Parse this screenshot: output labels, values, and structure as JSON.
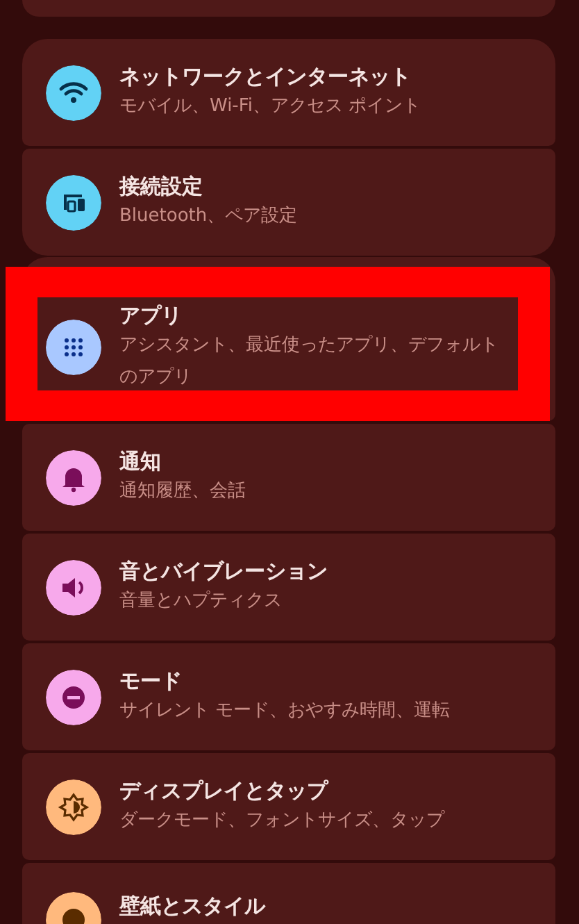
{
  "groups": [
    {
      "items": [
        {
          "title": "ネットワークとインターネット",
          "subtitle": "モバイル、Wi-Fi、アクセス ポイント",
          "kind": "wifi",
          "color": "#62d2f5",
          "highlighted": false
        },
        {
          "title": "接続設定",
          "subtitle": "Bluetooth、ペア設定",
          "kind": "devices",
          "color": "#62d2f5",
          "highlighted": false
        }
      ]
    },
    {
      "items": [
        {
          "title": "アプリ",
          "subtitle": "アシスタント、最近使ったアプリ、デフォルトのアプリ",
          "kind": "grid",
          "color": "#a9c8ff",
          "highlighted": true
        },
        {
          "title": "通知",
          "subtitle": "通知履歴、会話",
          "kind": "bell",
          "color": "#f7a9eb",
          "highlighted": false
        },
        {
          "title": "音とバイブレーション",
          "subtitle": "音量とハプティクス",
          "kind": "speaker",
          "color": "#f7a9eb",
          "highlighted": false
        },
        {
          "title": "モード",
          "subtitle": "サイレント モード、おやすみ時間、運転",
          "kind": "minus",
          "color": "#f7a9eb",
          "highlighted": false
        },
        {
          "title": "ディスプレイとタップ",
          "subtitle": "ダークモード、フォントサイズ、タップ",
          "kind": "brightness",
          "color": "#ffb97d",
          "highlighted": false
        },
        {
          "title": "壁紙とスタイル",
          "kind": "palette",
          "color": "#ffb97d",
          "highlighted": false
        }
      ]
    }
  ]
}
